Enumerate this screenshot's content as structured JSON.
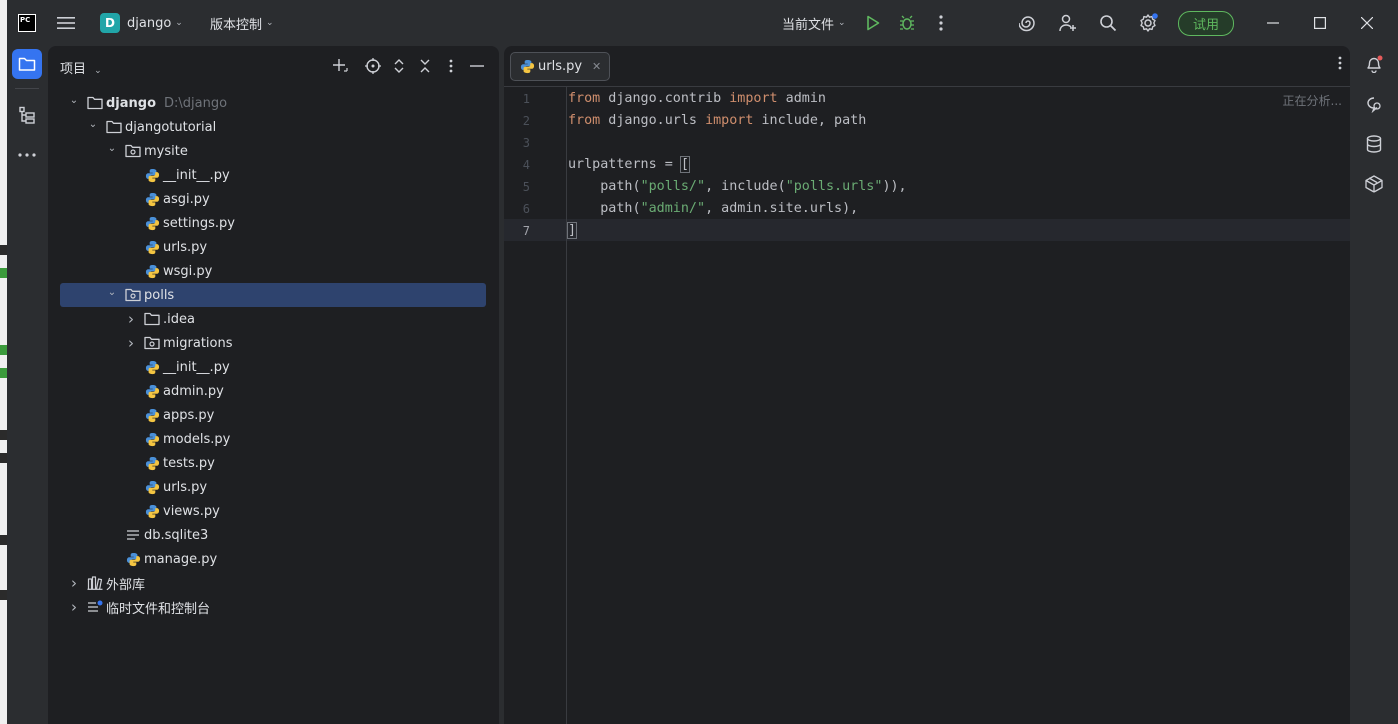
{
  "titlebar": {
    "app_logo": "PC",
    "project_badge": "D",
    "project_name": "django",
    "vcs_menu": "版本控制",
    "run_config": "当前文件",
    "trial_button": "试用"
  },
  "project_panel": {
    "title": "项目",
    "tree": [
      {
        "label": "django",
        "extra": "D:\\django",
        "depth": 0,
        "expanded": true,
        "type": "folder",
        "bold": true
      },
      {
        "label": "djangotutorial",
        "depth": 1,
        "expanded": true,
        "type": "folder"
      },
      {
        "label": "mysite",
        "depth": 2,
        "expanded": true,
        "type": "package"
      },
      {
        "label": "__init__.py",
        "depth": 3,
        "type": "python"
      },
      {
        "label": "asgi.py",
        "depth": 3,
        "type": "python"
      },
      {
        "label": "settings.py",
        "depth": 3,
        "type": "python"
      },
      {
        "label": "urls.py",
        "depth": 3,
        "type": "python"
      },
      {
        "label": "wsgi.py",
        "depth": 3,
        "type": "python"
      },
      {
        "label": "polls",
        "depth": 2,
        "expanded": true,
        "type": "package",
        "selected": true
      },
      {
        "label": ".idea",
        "depth": 3,
        "expanded": false,
        "type": "folder"
      },
      {
        "label": "migrations",
        "depth": 3,
        "expanded": false,
        "type": "package"
      },
      {
        "label": "__init__.py",
        "depth": 3,
        "type": "python"
      },
      {
        "label": "admin.py",
        "depth": 3,
        "type": "python"
      },
      {
        "label": "apps.py",
        "depth": 3,
        "type": "python"
      },
      {
        "label": "models.py",
        "depth": 3,
        "type": "python"
      },
      {
        "label": "tests.py",
        "depth": 3,
        "type": "python"
      },
      {
        "label": "urls.py",
        "depth": 3,
        "type": "python"
      },
      {
        "label": "views.py",
        "depth": 3,
        "type": "python"
      },
      {
        "label": "db.sqlite3",
        "depth": 2,
        "type": "text"
      },
      {
        "label": "manage.py",
        "depth": 2,
        "type": "python"
      },
      {
        "label": "外部库",
        "depth": 0,
        "expanded": false,
        "type": "library"
      },
      {
        "label": "临时文件和控制台",
        "depth": 0,
        "expanded": false,
        "type": "scratch"
      }
    ]
  },
  "editor": {
    "tab_label": "urls.py",
    "status": "正在分析...",
    "current_line": 7,
    "lines": [
      [
        [
          "kw",
          "from"
        ],
        [
          "t",
          " django.contrib "
        ],
        [
          "kw",
          "import"
        ],
        [
          "t",
          " admin"
        ]
      ],
      [
        [
          "kw",
          "from"
        ],
        [
          "t",
          " django.urls "
        ],
        [
          "kw",
          "import"
        ],
        [
          "t",
          " include, path"
        ]
      ],
      [],
      [
        [
          "t",
          "urlpatterns = "
        ],
        [
          "br",
          "["
        ]
      ],
      [
        [
          "t",
          "    path("
        ],
        [
          "str",
          "\"polls/\""
        ],
        [
          "t",
          ", include("
        ],
        [
          "str",
          "\"polls.urls\""
        ],
        [
          "t",
          ")),"
        ]
      ],
      [
        [
          "t",
          "    path("
        ],
        [
          "str",
          "\"admin/\""
        ],
        [
          "t",
          ", admin.site.urls),"
        ]
      ],
      [
        [
          "br",
          "]"
        ]
      ]
    ]
  },
  "colors": {
    "keyword": "#cf8e6d",
    "string": "#6aab73",
    "selection": "#2e436e",
    "accent": "#3574f0",
    "trial": "#5fb85f"
  }
}
